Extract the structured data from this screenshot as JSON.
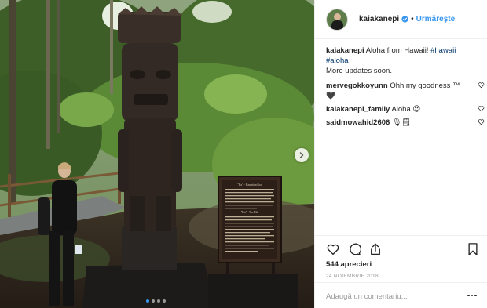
{
  "photo": {
    "sign_heading_1": "\"Ku\" - Hawaiian God",
    "sign_heading_2": "\"Ku\" - The Tiki",
    "carousel_dots": 4,
    "active_dot": 1
  },
  "header": {
    "username": "kaiakanepi",
    "separator": "•",
    "follow_label": "Urmărește"
  },
  "caption": {
    "username": "kaiakanepi",
    "text": "Aloha from Hawaii!",
    "hashtags": [
      "#hawaii",
      "#aloha"
    ],
    "more_text": "More updates soon."
  },
  "comments": [
    {
      "username": "mervegokkoyunn",
      "text": "Ohh my goodness ™🖤"
    },
    {
      "username": "kaiakanepi_family",
      "text": "Aloha 😍"
    },
    {
      "username": "saidmowahid2606",
      "text": "🎙🗒"
    }
  ],
  "actions": {
    "likes": "544 aprecieri",
    "date": "24 NOIEMBRIE 2018"
  },
  "add_comment": {
    "placeholder": "Adaugă un comentariu..."
  },
  "colors": {
    "accent": "#3897f0",
    "text": "#262626",
    "muted": "#999999",
    "border": "#efefef",
    "hashtag": "#003569"
  }
}
